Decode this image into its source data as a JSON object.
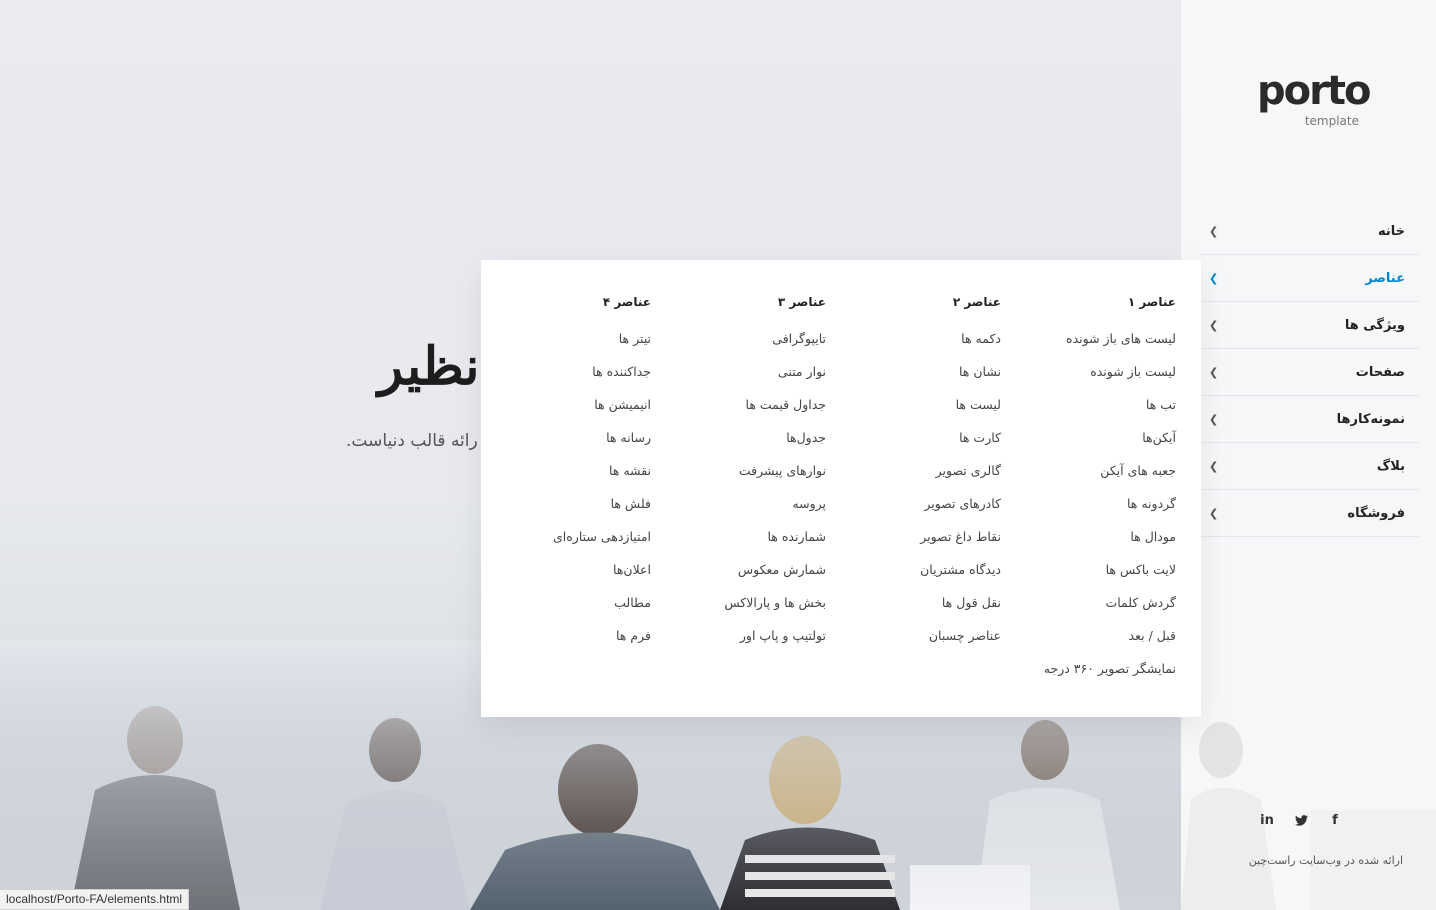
{
  "hero": {
    "title": "نظیر",
    "subtitle": "رائه قالب دنیاست."
  },
  "sidebar": {
    "logo": {
      "word": "porto",
      "tag": "template"
    },
    "nav": [
      {
        "label": "خانه",
        "active": false
      },
      {
        "label": "عناصر",
        "active": true
      },
      {
        "label": "ویژگی ها",
        "active": false
      },
      {
        "label": "صفحات",
        "active": false
      },
      {
        "label": "نمونه‌کارها",
        "active": false
      },
      {
        "label": "بلاگ",
        "active": false
      },
      {
        "label": "فروشگاه",
        "active": false
      }
    ],
    "social": [
      {
        "icon": "linkedin-icon",
        "glyph": "in"
      },
      {
        "icon": "twitter-icon",
        "glyph": "🐦"
      },
      {
        "icon": "facebook-icon",
        "glyph": "f"
      }
    ],
    "credit": "ارائه شده در وب‌سایت راست‌چین"
  },
  "mega_menu": {
    "columns": [
      {
        "heading": "عناصر ۱",
        "items": [
          "لیست های باز شونده",
          "لیست باز شونده",
          "تب ها",
          "آیکن‌ها",
          "جعبه های آیکن",
          "گردونه ها",
          "مودال ها",
          "لایت باکس ها",
          "گردش کلمات",
          "قبل / بعد",
          "نمایشگر تصویر ۳۶۰ درجه"
        ]
      },
      {
        "heading": "عناصر ۲",
        "items": [
          "دکمه ها",
          "نشان ها",
          "لیست ها",
          "کارت ها",
          "گالری تصویر",
          "کادرهای تصویر",
          "نقاط داغ تصویر",
          "دیدگاه مشتریان",
          "نقل قول ها",
          "عناصر چسبان"
        ]
      },
      {
        "heading": "عناصر ۳",
        "items": [
          "تایپوگرافی",
          "نوار متنی",
          "جداول قیمت ها",
          "جدول‌ها",
          "نوارهای پیشرفت",
          "پروسه",
          "شمارنده ها",
          "شمارش معکوس",
          "بخش ها و پارالاکس",
          "تولتیپ و پاپ اور"
        ]
      },
      {
        "heading": "عناصر ۴",
        "items": [
          "تیتر ها",
          "جداکننده ها",
          "انیمیشن ها",
          "رسانه ها",
          "نقشه ها",
          "فلش ها",
          "امتیازدهی ستاره‌ای",
          "اعلان‌ها",
          "مطالب",
          "فرم ها"
        ]
      }
    ]
  },
  "status_bar": {
    "url": "localhost/Porto-FA/elements.html"
  },
  "colors": {
    "accent": "#0088cc",
    "text": "#222222",
    "menu_bg": "#ffffff",
    "sidebar_bg": "#f6f7f9"
  }
}
